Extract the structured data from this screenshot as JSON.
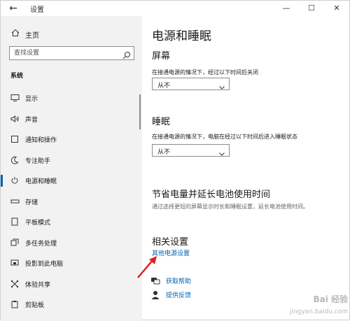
{
  "window": {
    "title": "设置",
    "controls": {
      "minimize": "—",
      "maximize": "☐",
      "close": "✕"
    }
  },
  "sidebar": {
    "home_label": "主页",
    "search_placeholder": "查找设置",
    "section_label": "系统",
    "items": [
      {
        "label": "显示",
        "icon": "monitor-icon",
        "glyph": "▭"
      },
      {
        "label": "声音",
        "icon": "speaker-icon",
        "glyph": "🔈"
      },
      {
        "label": "通知和操作",
        "icon": "notification-icon",
        "glyph": "▢"
      },
      {
        "label": "专注助手",
        "icon": "moon-icon",
        "glyph": "☾"
      },
      {
        "label": "电源和睡眠",
        "icon": "power-icon",
        "glyph": "⏻"
      },
      {
        "label": "存储",
        "icon": "storage-icon",
        "glyph": "▬"
      },
      {
        "label": "平板模式",
        "icon": "tablet-icon",
        "glyph": "▯"
      },
      {
        "label": "多任务处理",
        "icon": "multitask-icon",
        "glyph": "▤"
      },
      {
        "label": "投影到此电脑",
        "icon": "project-icon",
        "glyph": "⧉"
      },
      {
        "label": "体验共享",
        "icon": "share-icon",
        "glyph": "✕"
      },
      {
        "label": "剪贴板",
        "icon": "clipboard-icon",
        "glyph": "▣"
      }
    ],
    "active_index": 4
  },
  "main": {
    "title": "电源和睡眠",
    "screen": {
      "heading": "屏幕",
      "desc": "在接通电源的情况下，经过以下时间后关闭",
      "value": "从不"
    },
    "sleep": {
      "heading": "睡眠",
      "desc": "在接通电源的情况下，电脑在经过以下时间后进入睡眠状态",
      "value": "从不"
    },
    "battery": {
      "heading": "节省电量并延长电池使用时间",
      "desc": "通过选择更短的屏幕显示时长和睡眠设置，延长电池使用时间。"
    },
    "related": {
      "heading": "相关设置",
      "link": "其他电源设置"
    },
    "help": {
      "get_help": "获取帮助",
      "feedback": "提供反馈"
    }
  },
  "watermark": {
    "top": "Bai 经验",
    "bottom": "jingyan.baidu.com"
  },
  "colors": {
    "accent": "#0063b1",
    "sidebar_bg": "#f2f2f2",
    "arrow": "#e02020"
  }
}
